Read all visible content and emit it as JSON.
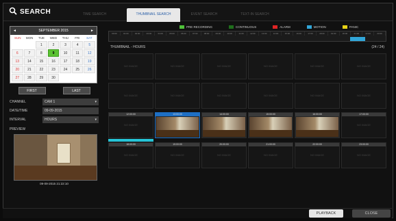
{
  "header": {
    "title": "SEARCH",
    "tabs": [
      {
        "label": "TIME SEARCH",
        "active": false
      },
      {
        "label": "THUMBNAIL SEARCH",
        "active": true
      },
      {
        "label": "EVENT SEARCH",
        "active": false
      },
      {
        "label": "TEXT-IN SEARCH",
        "active": false
      }
    ]
  },
  "legend": [
    {
      "label": "PRE RECORDING",
      "color": "#4fc13a"
    },
    {
      "label": "CONTINUOUS",
      "color": "#1f6e1c"
    },
    {
      "label": "ALARM",
      "color": "#e02424"
    },
    {
      "label": "MOTION",
      "color": "#31a6d8"
    },
    {
      "label": "PANIC",
      "color": "#e8d316"
    }
  ],
  "timeline": {
    "hours": [
      "00:00",
      "01:00",
      "02:00",
      "03:00",
      "04:00",
      "05:00",
      "06:00",
      "07:00",
      "08:00",
      "09:00",
      "10:00",
      "11:00",
      "12:00",
      "13:00",
      "14:00",
      "15:00",
      "16:00",
      "17:00",
      "18:00",
      "19:00",
      "20:00",
      "21:00",
      "22:00",
      "23:00"
    ]
  },
  "calendar": {
    "month_label": "SEPTEMBER 2015",
    "prev": "◄",
    "next": "►",
    "days_of_week": [
      "SUN",
      "MON",
      "TUE",
      "WED",
      "THU",
      "FRI",
      "SAT"
    ],
    "weeks": [
      [
        "",
        "",
        "1",
        "2",
        "3",
        "4",
        "5"
      ],
      [
        "6",
        "7",
        "8",
        "9",
        "10",
        "11",
        "12"
      ],
      [
        "13",
        "14",
        "15",
        "16",
        "17",
        "18",
        "19"
      ],
      [
        "20",
        "21",
        "22",
        "23",
        "24",
        "25",
        "26"
      ],
      [
        "27",
        "28",
        "29",
        "30",
        "",
        "",
        ""
      ]
    ],
    "selected_day": "9",
    "first_label": "FIRST",
    "last_label": "LAST"
  },
  "fields": {
    "channel_label": "CHANNEL",
    "channel_value": "CAM 1",
    "datetime_label": "DATE/TIME",
    "datetime_value": "09-09-2015",
    "interval_label": "INTERVAL",
    "interval_value": "HOURS"
  },
  "preview": {
    "label": "PREVIEW",
    "timestamp": "09-09-2015  21:22:10"
  },
  "thumbnails": {
    "header_left": "THUMBNAIL - HOURS",
    "header_right": "(24 / 24)",
    "no_image": "NO IMAGE",
    "rows": [
      [
        {
          "t": ""
        },
        {
          "t": ""
        },
        {
          "t": ""
        },
        {
          "t": ""
        },
        {
          "t": ""
        },
        {
          "t": ""
        }
      ],
      [
        {
          "t": ""
        },
        {
          "t": ""
        },
        {
          "t": ""
        },
        {
          "t": ""
        },
        {
          "t": ""
        },
        {
          "t": ""
        }
      ],
      [
        {
          "t": "12:00:00",
          "img": false
        },
        {
          "t": "13:00:00",
          "img": true,
          "sel": true
        },
        {
          "t": "14:00:00",
          "img": true
        },
        {
          "t": "15:00:00",
          "img": true
        },
        {
          "t": "16:00:00",
          "img": true
        },
        {
          "t": "17:00:00",
          "img": false
        }
      ],
      [
        {
          "t": "18:00:00",
          "img": false
        },
        {
          "t": "19:00:00",
          "img": false
        },
        {
          "t": "20:00:00",
          "img": false
        },
        {
          "t": "21:00:00",
          "img": false
        },
        {
          "t": "22:00:00",
          "img": false
        },
        {
          "t": "23:00:00",
          "img": false
        }
      ]
    ]
  },
  "footer": {
    "playback_label": "PLAYBACK",
    "close_label": "CLOSE"
  }
}
